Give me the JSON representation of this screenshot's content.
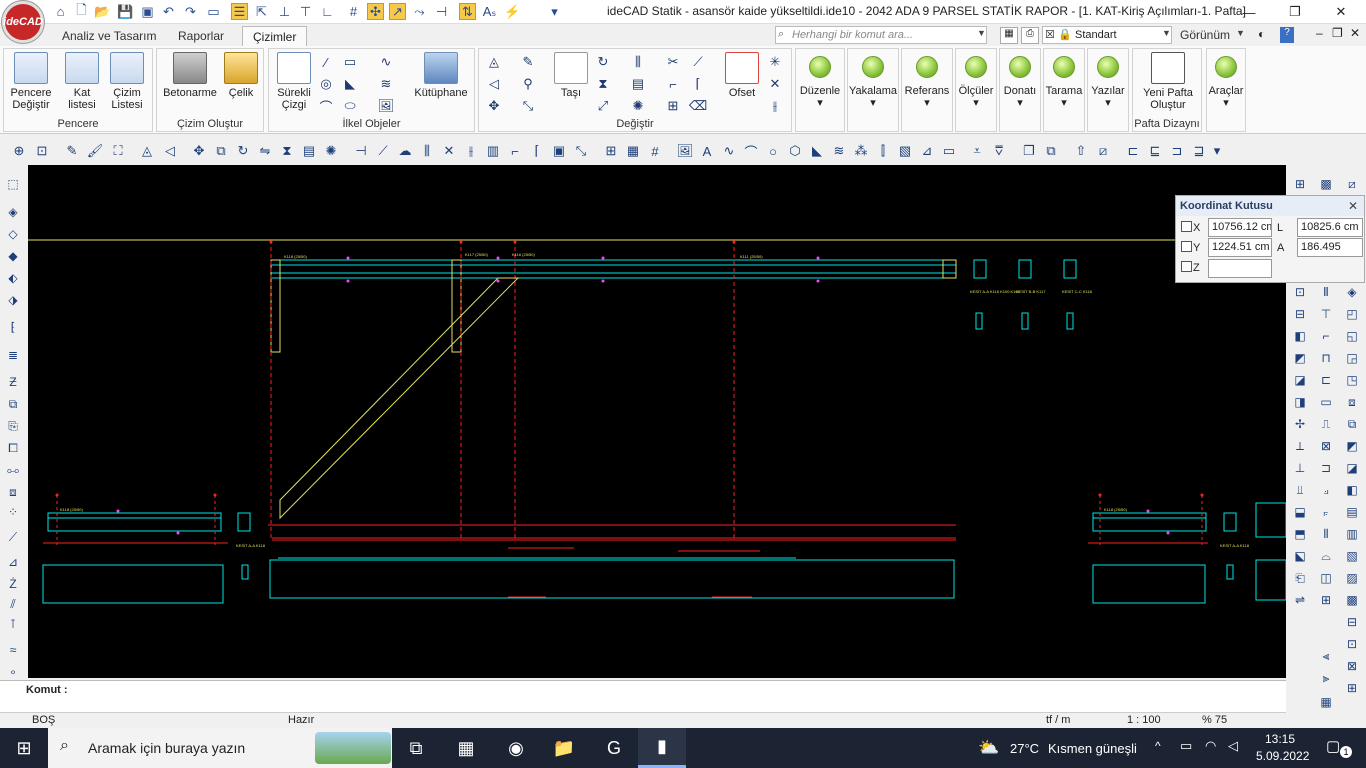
{
  "app": {
    "logo_text": "ideCAD",
    "title": "ideCAD Statik - asansör kaide yükseltildi.ide10 - 2042 ADA 9 PARSEL STATİK RAPOR - [1. KAT-Kiriş Açılımları-1. Pafta]"
  },
  "tabs": [
    "Analiz ve Tasarım",
    "Raporlar",
    "Çizimler"
  ],
  "active_tab": "Çizimler",
  "command_search": {
    "placeholder": "Herhangi bir komut ara..."
  },
  "style_select": {
    "value": "Standart"
  },
  "view_menu": "Görünüm",
  "ribbon": {
    "groups": [
      {
        "label": "Pencere",
        "buttons": [
          "Pencere Değiştir",
          "Kat listesi",
          "Çizim Listesi"
        ]
      },
      {
        "label": "Çizim Oluştur",
        "buttons": [
          "Betonarme",
          "Çelik"
        ]
      },
      {
        "label": "İlkel Objeler",
        "buttons": [
          "Sürekli Çizgi",
          "Kütüphane"
        ]
      },
      {
        "label": "Değiştir",
        "buttons": [
          "Taşı",
          "Ofset"
        ]
      },
      {
        "label": "",
        "buttons": [
          "Düzenle",
          "Yakalama",
          "Referans",
          "Ölçüler",
          "Donatı",
          "Tarama",
          "Yazılar"
        ]
      },
      {
        "label": "Pafta Dizaynı",
        "buttons": [
          "Yeni Pafta Oluştur"
        ]
      },
      {
        "label": "",
        "buttons": [
          "Araçlar"
        ]
      }
    ]
  },
  "coord_box": {
    "title": "Koordinat Kutusu",
    "x_label": "X",
    "x_value": "10756.12 cm",
    "y_label": "Y",
    "y_value": "1224.51 cm",
    "z_label": "Z",
    "z_value": "",
    "l_label": "L",
    "l_value": "10825.6 cm",
    "a_label": "A",
    "a_value": "186.495"
  },
  "drawing_labels": {
    "beams_top": [
      "K118 (25/50)",
      "K117 (25/50)",
      "K116 (25/50)",
      "K111 (25/50)"
    ],
    "sections": [
      "KESİT A-A K116 K100 K101",
      "KESİT B-B K117",
      "KESİT C-C K118"
    ],
    "bottom_left": [
      "K118 (25/50)",
      "KESİT A-A K118"
    ],
    "bottom_right": [
      "K118 (25/50)",
      "KESİT A-A K118"
    ]
  },
  "command_line": {
    "label": "Komut :",
    "value": ""
  },
  "status": {
    "mode": "BOŞ",
    "state": "Hazır",
    "unit": "tf / m",
    "scale": "1 : 100",
    "zoom": "% 75"
  },
  "taskbar": {
    "search_placeholder": "Aramak için buraya yazın",
    "weather_temp": "27°C",
    "weather_text": "Kısmen güneşli",
    "time": "13:15",
    "date": "5.09.2022",
    "notifications": "1"
  },
  "colors": {
    "canvas": "#000000",
    "cyan": "#00e5e5",
    "red": "#ff2020",
    "yellow": "#e0e060",
    "magenta": "#ff40ff"
  }
}
